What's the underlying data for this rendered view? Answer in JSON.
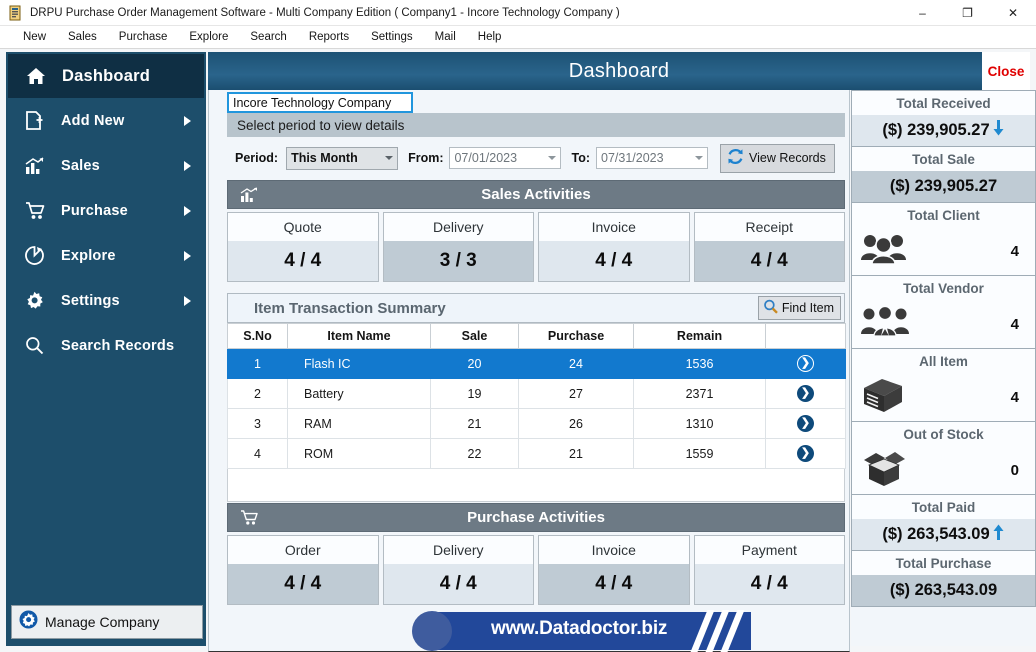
{
  "window": {
    "title": "DRPU Purchase Order Management Software - Multi Company Edition ( Company1 - Incore Technology Company )",
    "minimize": "–",
    "restore": "❐",
    "close": "✕"
  },
  "menubar": {
    "items": [
      {
        "label": "New"
      },
      {
        "label": "Sales"
      },
      {
        "label": "Purchase"
      },
      {
        "label": "Explore"
      },
      {
        "label": "Search"
      },
      {
        "label": "Reports"
      },
      {
        "label": "Settings"
      },
      {
        "label": "Mail"
      },
      {
        "label": "Help"
      }
    ]
  },
  "sidebar": {
    "items": [
      {
        "label": "Dashboard",
        "icon": "home-icon",
        "active": true,
        "arrow": false
      },
      {
        "label": "Add New",
        "icon": "file-plus-icon",
        "active": false,
        "arrow": true
      },
      {
        "label": "Sales",
        "icon": "bar-chart-icon",
        "active": false,
        "arrow": true
      },
      {
        "label": "Purchase",
        "icon": "cart-icon",
        "active": false,
        "arrow": true
      },
      {
        "label": "Explore",
        "icon": "pie-chart-icon",
        "active": false,
        "arrow": true
      },
      {
        "label": "Settings",
        "icon": "gear-icon",
        "active": false,
        "arrow": true
      },
      {
        "label": "Search Records",
        "icon": "magnifier-icon",
        "active": false,
        "arrow": false
      }
    ],
    "manage_company": "Manage Company"
  },
  "header": {
    "title": "Dashboard",
    "close_label": "Close"
  },
  "filters": {
    "company_name": "Incore Technology Company",
    "select_period_text": "Select period to view details",
    "period_label": "Period:",
    "period_value": "This Month",
    "from_label": "From:",
    "from_value": "07/01/2023",
    "to_label": "To:",
    "to_value": "07/31/2023",
    "view_records_label": "View Records"
  },
  "sales_activities": {
    "title": "Sales Activities",
    "cards": [
      {
        "label": "Quote",
        "value": "4 / 4",
        "tone": "light"
      },
      {
        "label": "Delivery",
        "value": "3 / 3",
        "tone": "dark"
      },
      {
        "label": "Invoice",
        "value": "4 / 4",
        "tone": "light"
      },
      {
        "label": "Receipt",
        "value": "4 / 4",
        "tone": "dark"
      }
    ]
  },
  "item_transaction_summary": {
    "title": "Item Transaction Summary",
    "find_item_label": "Find Item",
    "columns": [
      "S.No",
      "Item Name",
      "Sale",
      "Purchase",
      "Remain",
      ""
    ],
    "rows": [
      {
        "sno": "1",
        "item": "Flash IC",
        "sale": "20",
        "purchase": "24",
        "remain": "1536",
        "action": "❯",
        "selected": true
      },
      {
        "sno": "2",
        "item": "Battery",
        "sale": "19",
        "purchase": "27",
        "remain": "2371",
        "action": "❯",
        "selected": false
      },
      {
        "sno": "3",
        "item": "RAM",
        "sale": "21",
        "purchase": "26",
        "remain": "1310",
        "action": "❯",
        "selected": false
      },
      {
        "sno": "4",
        "item": "ROM",
        "sale": "22",
        "purchase": "21",
        "remain": "1559",
        "action": "❯",
        "selected": false
      }
    ]
  },
  "purchase_activities": {
    "title": "Purchase Activities",
    "cards": [
      {
        "label": "Order",
        "value": "4 / 4",
        "tone": "dark"
      },
      {
        "label": "Delivery",
        "value": "4 / 4",
        "tone": "light"
      },
      {
        "label": "Invoice",
        "value": "4 / 4",
        "tone": "dark"
      },
      {
        "label": "Payment",
        "value": "4 / 4",
        "tone": "light"
      }
    ]
  },
  "stats": [
    {
      "label": "Total Received",
      "value": "($) 239,905.27",
      "tone": "light",
      "trend": "down",
      "kind": "money"
    },
    {
      "label": "Total Sale",
      "value": "($) 239,905.27",
      "tone": "dark",
      "trend": "",
      "kind": "money"
    },
    {
      "label": "Total Client",
      "value": "4",
      "icon": "people-group-icon",
      "kind": "icon"
    },
    {
      "label": "Total Vendor",
      "value": "4",
      "icon": "vendor-group-icon",
      "kind": "icon"
    },
    {
      "label": "All Item",
      "value": "4",
      "icon": "box-closed-icon",
      "kind": "icon"
    },
    {
      "label": "Out of Stock",
      "value": "0",
      "icon": "box-open-icon",
      "kind": "icon"
    },
    {
      "label": "Total Paid",
      "value": "($) 263,543.09",
      "tone": "light",
      "trend": "up",
      "kind": "money"
    },
    {
      "label": "Total Purchase",
      "value": "($) 263,543.09",
      "tone": "dark",
      "trend": "",
      "kind": "money"
    }
  ],
  "watermark": {
    "text": "www.Datadoctor.biz"
  },
  "colors": {
    "sidebar_bg": "#1d4e6b",
    "sidebar_active": "#0f2f44",
    "header_blue": "#2a648b",
    "accent_blue": "#1279ce",
    "section_gray": "#6d7a85",
    "close_red": "#e00000",
    "trend_blue": "#1f8ad0",
    "watermark_blue": "#22489a"
  }
}
